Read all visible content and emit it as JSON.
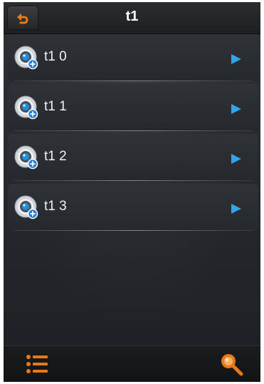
{
  "header": {
    "title": "t1",
    "back_icon": "back-arrow-icon"
  },
  "devices": [
    {
      "label": "t1 0",
      "icon": "camera-icon",
      "action_icon": "play-icon"
    },
    {
      "label": "t1 1",
      "icon": "camera-icon",
      "action_icon": "play-icon"
    },
    {
      "label": "t1 2",
      "icon": "camera-icon",
      "action_icon": "play-icon"
    },
    {
      "label": "t1 3",
      "icon": "camera-icon",
      "action_icon": "play-icon"
    }
  ],
  "footer": {
    "left_icon": "list-icon",
    "right_icon": "search-icon"
  },
  "colors": {
    "accent": "#e8791a",
    "play": "#2fa6e8",
    "background": "#202326",
    "text": "#f2f2f2"
  }
}
